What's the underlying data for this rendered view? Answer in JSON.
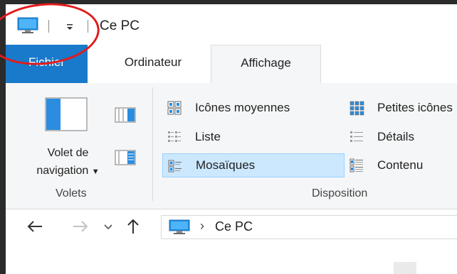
{
  "window": {
    "title": "Ce PC"
  },
  "tabs": [
    {
      "label": "Fichier"
    },
    {
      "label": "Ordinateur"
    },
    {
      "label": "Affichage"
    }
  ],
  "ribbon": {
    "panes_group": {
      "nav_pane_label_line1": "Volet de",
      "nav_pane_label_line2": "navigation",
      "title": "Volets"
    },
    "layout_group": {
      "title": "Disposition",
      "items": [
        {
          "label": "Icônes moyennes"
        },
        {
          "label": "Petites icônes"
        },
        {
          "label": "Liste"
        },
        {
          "label": "Détails"
        },
        {
          "label": "Mosaïques",
          "selected": true
        },
        {
          "label": "Contenu"
        }
      ]
    }
  },
  "address_bar": {
    "path_label": "Ce PC"
  },
  "colors": {
    "file_tab": "#1979ca",
    "ribbon_bg": "#f5f6f7",
    "selection": "#cce8ff",
    "annotation_circle": "#e21b1b"
  }
}
